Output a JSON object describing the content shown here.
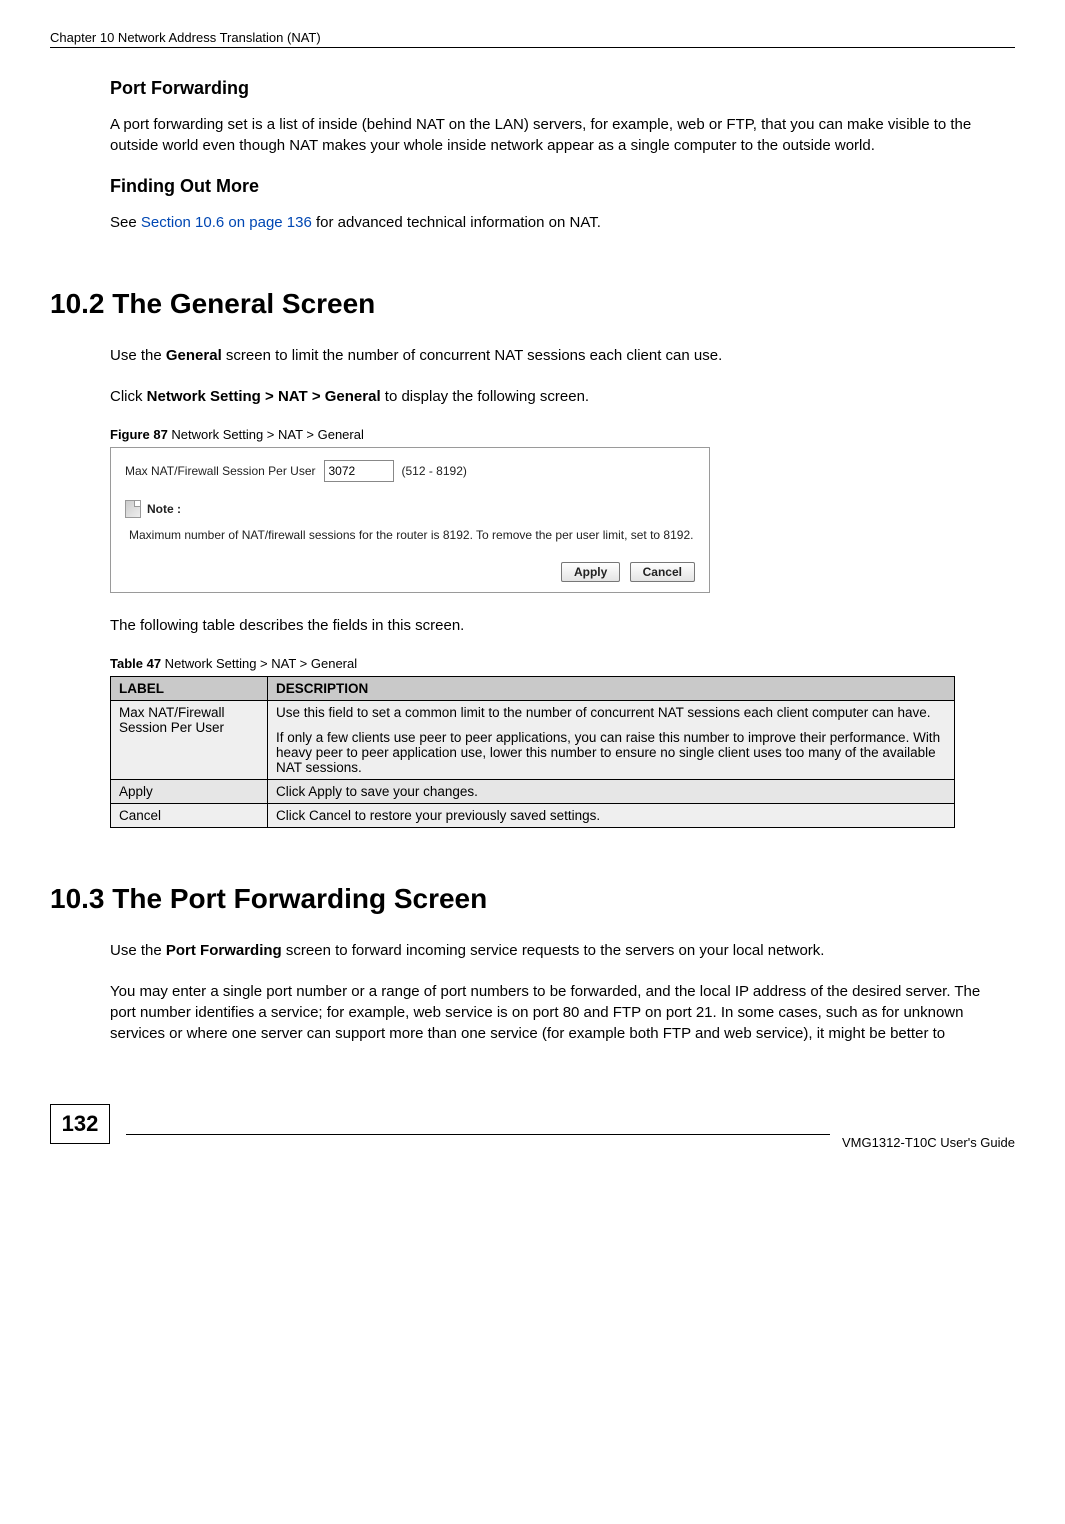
{
  "header": {
    "chapter_line": "Chapter 10 Network Address Translation (NAT)"
  },
  "sub1": {
    "heading": "Port Forwarding",
    "para": "A port forwarding set is a list of inside (behind NAT on the LAN) servers, for example, web or FTP, that you can make visible to the outside world even though NAT makes your whole inside network appear as a single computer to the outside world."
  },
  "sub2": {
    "heading": "Finding Out More",
    "para_pre": "See ",
    "para_link": "Section 10.6 on page 136",
    "para_post": " for advanced technical information on NAT."
  },
  "sec102": {
    "heading": "10.2  The General Screen",
    "p1_a": "Use the ",
    "p1_b": "General",
    "p1_c": " screen to limit the number of concurrent NAT sessions each client can use.",
    "p2_a": "Click ",
    "p2_b": "Network Setting > NAT > General",
    "p2_c": " to display the following screen.",
    "fig_num": "Figure 87",
    "fig_title": "   Network Setting > NAT > General",
    "screenshot": {
      "label": "Max NAT/Firewall Session Per User",
      "value": "3072",
      "range": "(512 - 8192)",
      "note_label": "Note :",
      "note_body": "Maximum number of NAT/firewall sessions for the router is 8192. To remove the per user limit, set to 8192.",
      "apply": "Apply",
      "cancel": "Cancel"
    },
    "tbl_intro": "The following table describes the fields in this screen.",
    "tbl_num": "Table 47",
    "tbl_title": "   Network Setting > NAT > General",
    "tbl": {
      "col1": "LABEL",
      "col2": "DESCRIPTION",
      "rows": [
        {
          "label": "Max NAT/Firewall Session Per User",
          "desc_p1": "Use this field to set a common limit to the number of concurrent NAT sessions each client computer can have.",
          "desc_p2": "If only a few clients use peer to peer applications, you can raise this number to improve their performance. With heavy peer to peer application use, lower this number to ensure no single client uses too many of the available NAT sessions."
        },
        {
          "label": "Apply",
          "desc_a": "Click ",
          "desc_b": "Apply",
          "desc_c": " to save your changes."
        },
        {
          "label": "Cancel",
          "desc_a": "Click ",
          "desc_b": "Cancel",
          "desc_c": " to restore your previously saved settings."
        }
      ]
    }
  },
  "sec103": {
    "heading": "10.3  The Port Forwarding Screen",
    "p1_a": "Use the ",
    "p1_b": "Port Forwarding",
    "p1_c": " screen to forward incoming service requests to the servers on your local network.",
    "p2": "You may enter a single port number or a range of port numbers to be forwarded, and the local IP address of the desired server. The port number identifies a service; for example, web service is on port 80 and FTP on port 21. In some cases, such as for unknown services or where one server can support more than one service (for example both FTP and web service), it might be better to"
  },
  "footer": {
    "page_num": "132",
    "guide": "VMG1312-T10C User's Guide"
  }
}
